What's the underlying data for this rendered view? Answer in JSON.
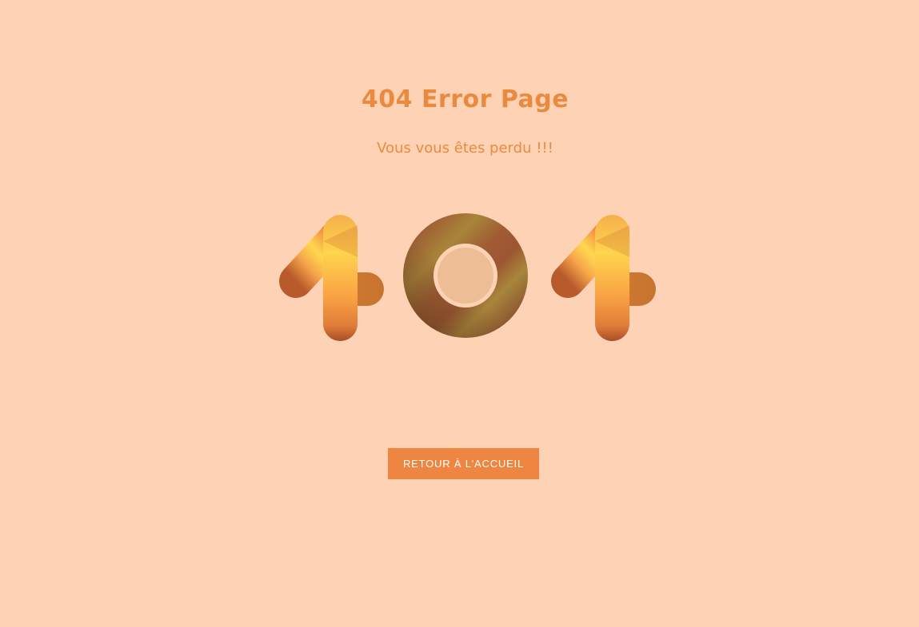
{
  "page": {
    "title": "404 Error Page",
    "subtitle": "Vous vous êtes perdu !!!",
    "illustration_text": "404",
    "home_button_label": "RETOUR À L'ACCUEIL"
  },
  "colors": {
    "background": "#FED3B5",
    "accent": "#EB8A3F",
    "button": "#EE8540",
    "button_text": "#FFFFFF",
    "ring_brown": "#A25D33",
    "ring_center": "#EDBD95",
    "gradient_yellow": "#FFD84D",
    "gradient_orange": "#F08A3A",
    "gradient_dark": "#B4582B"
  }
}
